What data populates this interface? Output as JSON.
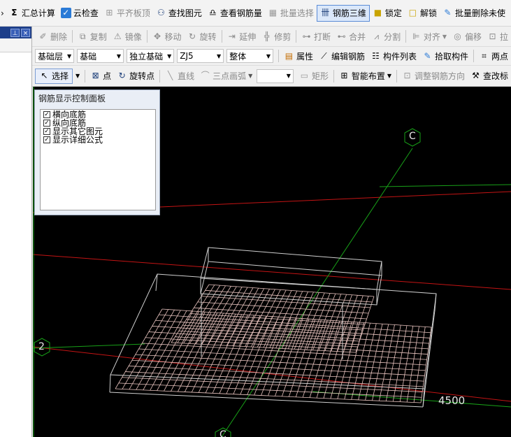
{
  "toolbar1": {
    "items": [
      {
        "label": "汇总计算",
        "icon": "sigma-icon",
        "glyph": "Σ"
      },
      {
        "label": "云检查",
        "icon": "cloud-check-icon",
        "glyph": "☑"
      },
      {
        "label": "平齐板顶",
        "icon": "align-slab-top-icon",
        "glyph": "⊞"
      },
      {
        "label": "查找图元",
        "icon": "binoculars-icon",
        "glyph": "⚇"
      },
      {
        "label": "查看钢筋量",
        "icon": "rebar-quantity-icon",
        "glyph": "♎"
      },
      {
        "label": "批量选择",
        "icon": "batch-select-icon",
        "glyph": "▦"
      },
      {
        "label": "钢筋三维",
        "icon": "rebar-3d-icon",
        "glyph": "卌"
      },
      {
        "label": "锁定",
        "icon": "lock-icon",
        "glyph": "🔒"
      },
      {
        "label": "解锁",
        "icon": "unlock-icon",
        "glyph": "🔓"
      },
      {
        "label": "批量删除未使",
        "icon": "batch-delete-icon",
        "glyph": "✎"
      }
    ]
  },
  "toolbar2": {
    "items": [
      {
        "label": "删除",
        "icon": "delete-icon",
        "glyph": "✐"
      },
      {
        "label": "复制",
        "icon": "copy-icon",
        "glyph": "⧉"
      },
      {
        "label": "镜像",
        "icon": "mirror-icon",
        "glyph": "⚠"
      },
      {
        "label": "移动",
        "icon": "move-icon",
        "glyph": "✥"
      },
      {
        "label": "旋转",
        "icon": "rotate-icon",
        "glyph": "↻"
      },
      {
        "label": "延伸",
        "icon": "extend-icon",
        "glyph": "⇥"
      },
      {
        "label": "修剪",
        "icon": "trim-icon",
        "glyph": "╬"
      },
      {
        "label": "打断",
        "icon": "break-icon",
        "glyph": "⊶"
      },
      {
        "label": "合并",
        "icon": "merge-icon",
        "glyph": "⊷"
      },
      {
        "label": "分割",
        "icon": "split-icon",
        "glyph": "⩘"
      },
      {
        "label": "对齐",
        "icon": "align-icon",
        "glyph": "⊫"
      },
      {
        "label": "偏移",
        "icon": "offset-icon",
        "glyph": "◎"
      },
      {
        "label": "拉",
        "icon": "stretch-icon",
        "glyph": "⊡"
      }
    ]
  },
  "toolbar3": {
    "floor": "基础层",
    "category": "基础",
    "type": "独立基础",
    "component": "ZJ5",
    "scope": "整体",
    "buttons": [
      {
        "label": "属性",
        "icon": "properties-icon",
        "glyph": "▤"
      },
      {
        "label": "编辑钢筋",
        "icon": "edit-rebar-icon",
        "glyph": "⟋"
      },
      {
        "label": "构件列表",
        "icon": "component-list-icon",
        "glyph": "☷"
      },
      {
        "label": "拾取构件",
        "icon": "pick-component-icon",
        "glyph": "✎"
      },
      {
        "label": "两点",
        "icon": "two-point-icon",
        "glyph": "⌗"
      }
    ]
  },
  "toolbar4": {
    "select": "选择",
    "items": [
      {
        "label": "点",
        "icon": "point-icon",
        "glyph": "⊠",
        "disabled": false
      },
      {
        "label": "旋转点",
        "icon": "rotate-point-icon",
        "glyph": "↻",
        "disabled": false
      },
      {
        "label": "直线",
        "icon": "line-icon",
        "glyph": "╲",
        "disabled": true
      },
      {
        "label": "三点画弧",
        "icon": "arc-icon",
        "glyph": "⌒",
        "disabled": true
      },
      {
        "label": "矩形",
        "icon": "rectangle-icon",
        "glyph": "▭",
        "disabled": true
      },
      {
        "label": "智能布置",
        "icon": "smart-layout-icon",
        "glyph": "⊞",
        "disabled": false
      },
      {
        "label": "调整钢筋方向",
        "icon": "adjust-rebar-direction-icon",
        "glyph": "⊡",
        "disabled": true
      },
      {
        "label": "查改标",
        "icon": "check-label-icon",
        "glyph": "⚒",
        "disabled": false
      }
    ],
    "empty_dropdown": ""
  },
  "left_panel": {
    "pin": "⊥",
    "close": "×"
  },
  "control_panel": {
    "title": "钢筋显示控制面板",
    "options": [
      {
        "label": "横向底筋",
        "checked": true
      },
      {
        "label": "纵向底筋",
        "checked": true
      },
      {
        "label": "显示其它图元",
        "checked": true
      },
      {
        "label": "显示详细公式",
        "checked": true
      }
    ]
  },
  "viewport": {
    "axis_labels": [
      "C",
      "2",
      "C"
    ],
    "dimension": "4500",
    "colors": {
      "grid_red": "#c41414",
      "grid_green": "#18a018",
      "wireframe": "#cfcfcf",
      "mesh": "#e8c4bf"
    }
  }
}
